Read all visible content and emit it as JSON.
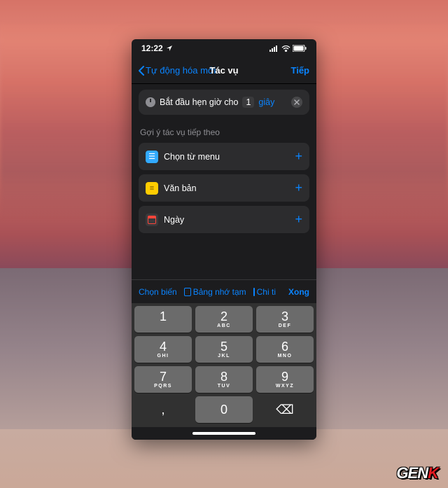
{
  "status": {
    "time": "12:22"
  },
  "nav": {
    "back": "Tự động hóa mới",
    "title": "Tác vụ",
    "next": "Tiếp"
  },
  "action": {
    "label": "Bắt đầu hẹn giờ cho",
    "value": "1",
    "unit": "giây"
  },
  "suggestions": {
    "header": "Gợi ý tác vụ tiếp theo",
    "items": [
      {
        "label": "Chọn từ menu"
      },
      {
        "label": "Văn bản"
      },
      {
        "label": "Ngày"
      }
    ]
  },
  "toolbar": {
    "var": "Chọn biến",
    "clip": "Bảng nhớ tạm",
    "more": "Chi tiế",
    "done": "Xong"
  },
  "keypad": {
    "k1": "1",
    "k2": "2",
    "k2s": "ABC",
    "k3": "3",
    "k3s": "DEF",
    "k4": "4",
    "k4s": "GHI",
    "k5": "5",
    "k5s": "JKL",
    "k6": "6",
    "k6s": "MNO",
    "k7": "7",
    "k7s": "PQRS",
    "k8": "8",
    "k8s": "TUV",
    "k9": "9",
    "k9s": "WXYZ",
    "k0": "0",
    "kd": ",",
    "del": "⌫"
  },
  "logo": {
    "gen": "GEN",
    "k": "K"
  }
}
